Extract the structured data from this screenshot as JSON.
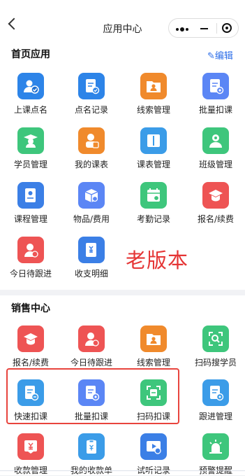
{
  "header": {
    "title": "应用中心"
  },
  "home_section": {
    "title": "首页应用",
    "edit_label": "编辑",
    "items": [
      {
        "label": "上课点名",
        "color": "#2d84e8",
        "icon": "user-check-icon"
      },
      {
        "label": "点名记录",
        "color": "#2d84e8",
        "icon": "document-check-icon"
      },
      {
        "label": "线索管理",
        "color": "#f08a2c",
        "icon": "folder-user-icon"
      },
      {
        "label": "批量扣课",
        "color": "#5b86f5",
        "icon": "document-batch-icon"
      },
      {
        "label": "学员管理",
        "color": "#3ec67c",
        "icon": "student-icon"
      },
      {
        "label": "我的课表",
        "color": "#f08a2c",
        "icon": "person-schedule-icon"
      },
      {
        "label": "课表管理",
        "color": "#3b9ce8",
        "icon": "book-icon"
      },
      {
        "label": "班级管理",
        "color": "#3ec67c",
        "icon": "class-icon"
      },
      {
        "label": "课程管理",
        "color": "#3b7fe6",
        "icon": "course-book-icon"
      },
      {
        "label": "物品/费用",
        "color": "#5b86f5",
        "icon": "box-icon"
      },
      {
        "label": "考勤记录",
        "color": "#3ec67c",
        "icon": "calendar-icon"
      },
      {
        "label": "报名/续费",
        "color": "#ee5454",
        "icon": "graduation-cap-icon"
      },
      {
        "label": "今日待跟进",
        "color": "#ee5454",
        "icon": "follow-up-icon"
      },
      {
        "label": "收支明细",
        "color": "#3b7fe6",
        "icon": "ledger-icon"
      }
    ]
  },
  "annotation": {
    "text": "老版本"
  },
  "sales_section": {
    "title": "销售中心",
    "items": [
      {
        "label": "报名/续费",
        "color": "#ee5454",
        "icon": "graduation-cap-icon"
      },
      {
        "label": "今日待跟进",
        "color": "#ee5454",
        "icon": "follow-up-icon"
      },
      {
        "label": "线索管理",
        "color": "#f08a2c",
        "icon": "folder-user-icon"
      },
      {
        "label": "扫码搜学员",
        "color": "#3ec67c",
        "icon": "scan-search-icon"
      },
      {
        "label": "快速扣课",
        "color": "#3b9ce8",
        "icon": "quick-deduct-icon"
      },
      {
        "label": "批量扣课",
        "color": "#5b86f5",
        "icon": "document-batch-icon"
      },
      {
        "label": "扫码扣课",
        "color": "#3ec67c",
        "icon": "scan-deduct-icon"
      },
      {
        "label": "跟进管理",
        "color": "#3b9ce8",
        "icon": "follow-manage-icon"
      },
      {
        "label": "收款管理",
        "color": "#ee5454",
        "icon": "payment-icon"
      },
      {
        "label": "我的收款单",
        "color": "#3b9ce8",
        "icon": "receipt-icon"
      },
      {
        "label": "试听记录",
        "color": "#3b7fe6",
        "icon": "trial-video-icon"
      },
      {
        "label": "预警提醒",
        "color": "#3ec67c",
        "icon": "alarm-icon"
      }
    ]
  }
}
